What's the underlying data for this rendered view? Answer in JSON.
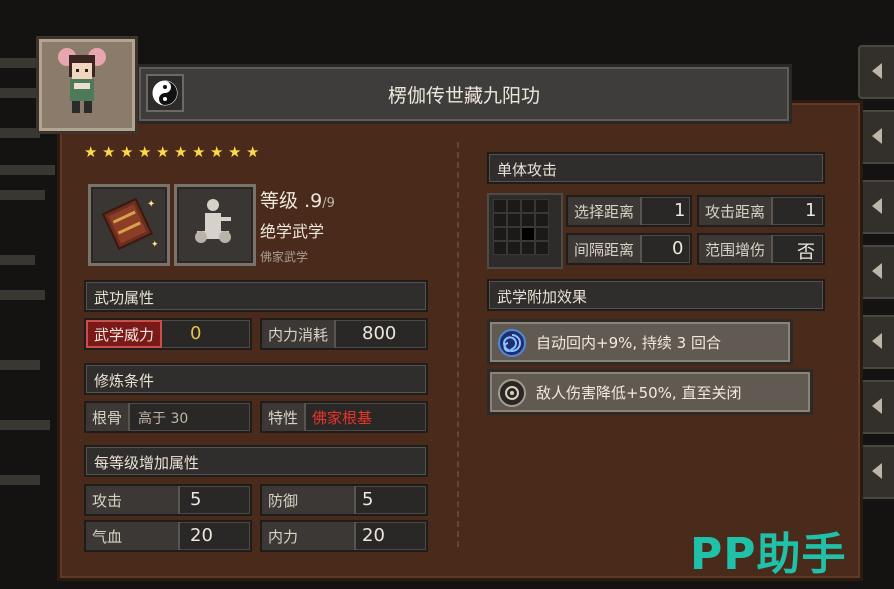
{
  "title": "楞伽传世藏九阳功",
  "stars": 10,
  "level": {
    "label": "等级",
    "value": ".9",
    "max": "/9"
  },
  "rank": "绝学武学",
  "school": "佛家武学",
  "sections": {
    "attributes": "武功属性",
    "requirements": "修炼条件",
    "per_level": "每等级增加属性",
    "single_attack": "单体攻击",
    "bonus_effects": "武学附加效果"
  },
  "attributes": [
    {
      "label": "武学威力",
      "value": "0"
    },
    {
      "label": "内力消耗",
      "value": "800"
    }
  ],
  "requirements": [
    {
      "label": "根骨",
      "value": "高于 30"
    },
    {
      "label": "特性",
      "value": "佛家根基"
    }
  ],
  "per_level": [
    {
      "label": "攻击",
      "value": "5"
    },
    {
      "label": "防御",
      "value": "5"
    },
    {
      "label": "气血",
      "value": "20"
    },
    {
      "label": "内力",
      "value": "20"
    }
  ],
  "attack_stats": [
    {
      "label": "选择距离",
      "value": "1"
    },
    {
      "label": "攻击距离",
      "value": "1"
    },
    {
      "label": "间隔距离",
      "value": "0"
    },
    {
      "label": "范围增伤",
      "value": "否"
    }
  ],
  "effects": [
    {
      "text": "自动回内+9%, 持续 3 回合",
      "icon": "swirl-icon"
    },
    {
      "text": "敌人伤害降低+50%, 直至关闭",
      "icon": "target-icon"
    }
  ],
  "watermark": "PP助手",
  "colors": {
    "star": "#ffd84a",
    "trait_red": "#e8332b",
    "highlight": "#e8c14a",
    "watermark": "#1fc1a8"
  }
}
